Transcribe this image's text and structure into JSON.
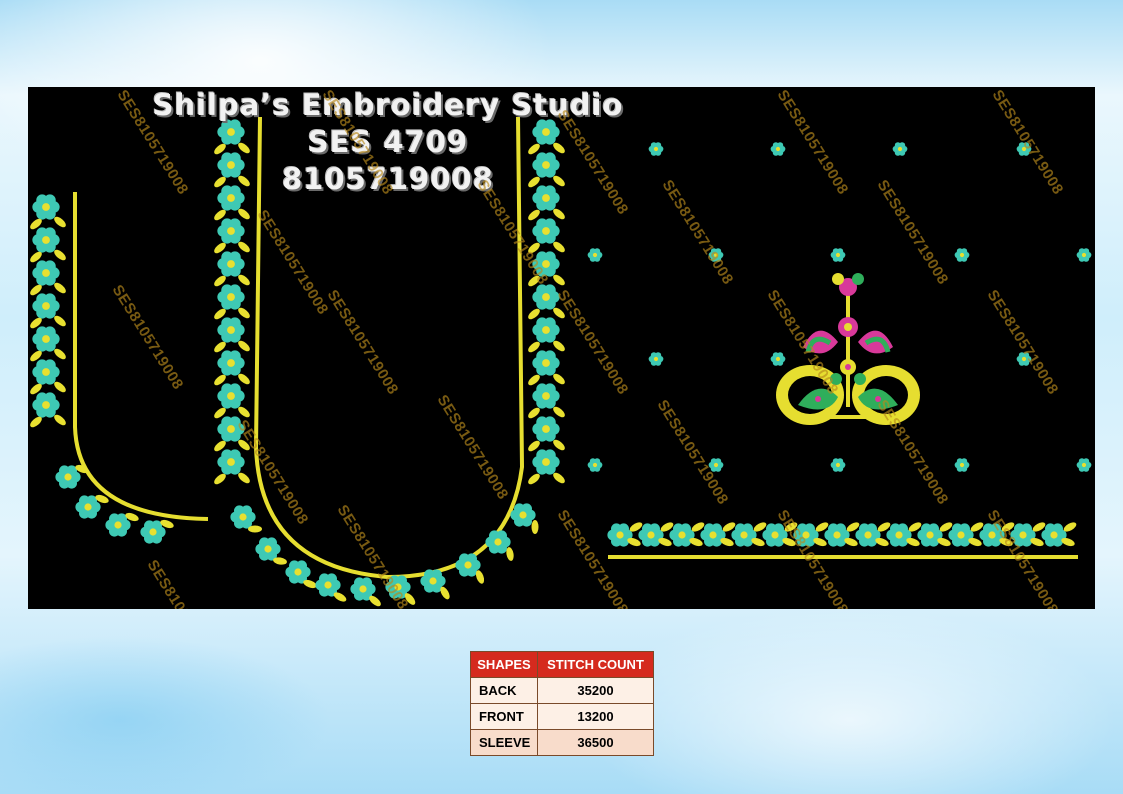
{
  "header": {
    "studio_name": "Shilpa’s Embroidery Studio",
    "design_code": "SES 4709",
    "phone": "8105719008"
  },
  "watermark_text": "SES8105719008",
  "colors": {
    "background": "#000000",
    "thread_yellow": "#e8e030",
    "thread_turquoise": "#3ec9b4",
    "thread_pink": "#d8399a",
    "table_header": "#d52a1e"
  },
  "table": {
    "headers": [
      "SHAPES",
      "STITCH COUNT"
    ],
    "rows": [
      {
        "shape": "BACK",
        "count": "35200"
      },
      {
        "shape": "FRONT",
        "count": "13200"
      },
      {
        "shape": "SLEEVE",
        "count": "36500"
      }
    ]
  }
}
